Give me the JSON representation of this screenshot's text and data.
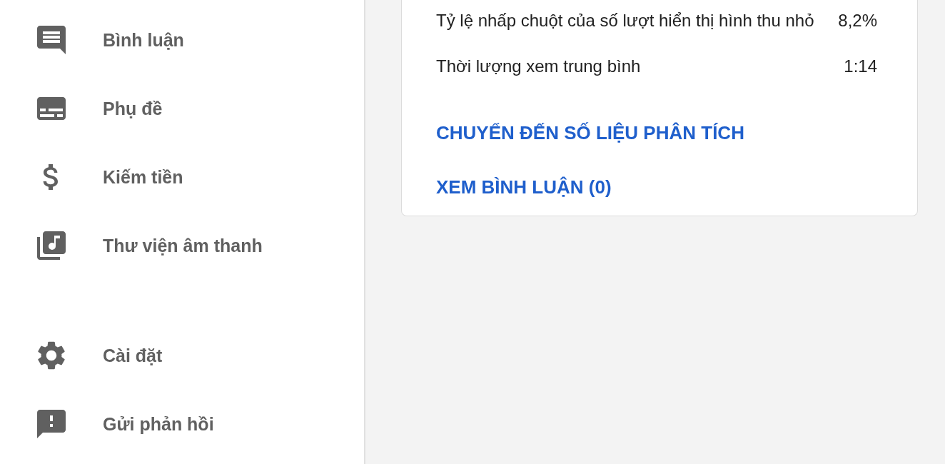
{
  "sidebar": {
    "groups": [
      {
        "items": [
          {
            "label": "Bình luận"
          },
          {
            "label": "Phụ đề"
          },
          {
            "label": "Kiếm tiền"
          },
          {
            "label": "Thư viện âm thanh"
          }
        ]
      },
      {
        "items": [
          {
            "label": "Cài đặt"
          },
          {
            "label": "Gửi phản hồi"
          }
        ]
      }
    ]
  },
  "card": {
    "metrics": [
      {
        "label": "Tỷ lệ nhấp chuột của số lượt hiển thị hình thu nhỏ",
        "value": "8,2%"
      },
      {
        "label": "Thời lượng xem trung bình",
        "value": "1:14"
      }
    ],
    "links": [
      "CHUYỂN ĐẾN SỐ LIỆU PHÂN TÍCH",
      "XEM BÌNH LUẬN (0)"
    ]
  }
}
